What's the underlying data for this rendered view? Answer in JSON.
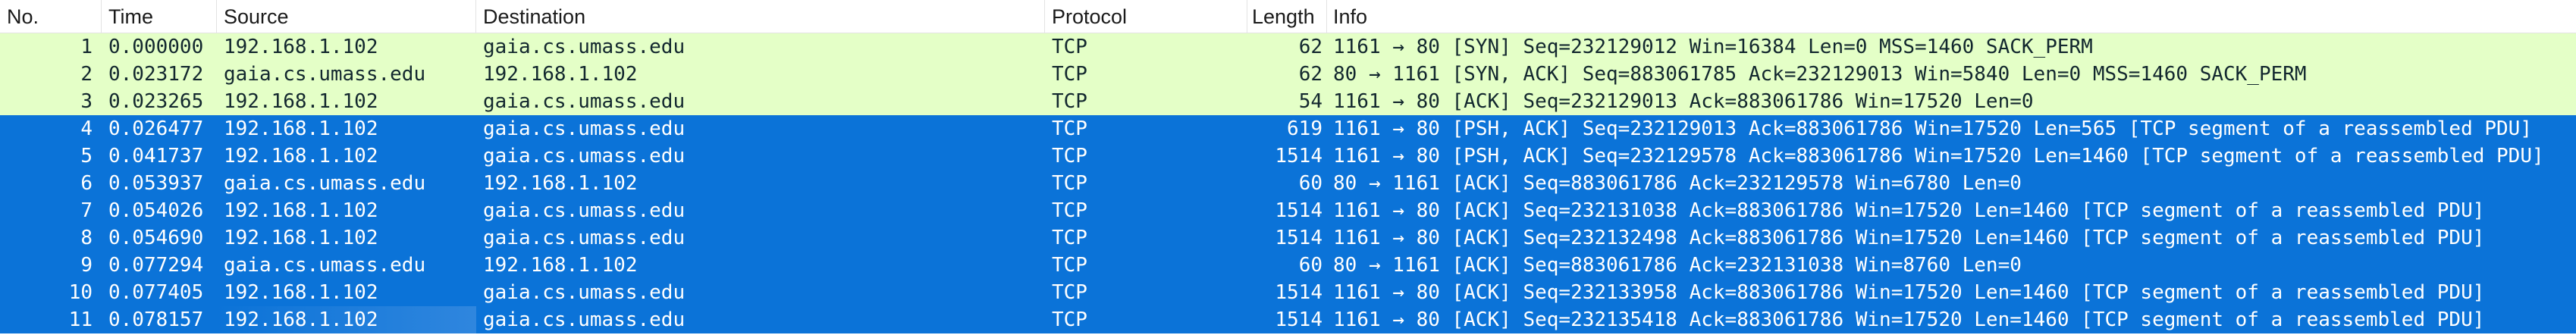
{
  "columns": {
    "no": "No.",
    "time": "Time",
    "source": "Source",
    "destination": "Destination",
    "protocol": "Protocol",
    "length": "Length",
    "info": "Info"
  },
  "colors": {
    "tcp_handshake_row": "#e4ffc7",
    "selected_row": "#0b73d8",
    "selected_text": "#ffffff"
  },
  "rows": [
    {
      "no": "1",
      "time": "0.000000",
      "source": "192.168.1.102",
      "destination": "gaia.cs.umass.edu",
      "protocol": "TCP",
      "length": "62",
      "info": "1161 → 80 [SYN] Seq=232129012 Win=16384 Len=0 MSS=1460 SACK_PERM",
      "style": "green"
    },
    {
      "no": "2",
      "time": "0.023172",
      "source": "gaia.cs.umass.edu",
      "destination": "192.168.1.102",
      "protocol": "TCP",
      "length": "62",
      "info": "80 → 1161 [SYN, ACK] Seq=883061785 Ack=232129013 Win=5840 Len=0 MSS=1460 SACK_PERM",
      "style": "green"
    },
    {
      "no": "3",
      "time": "0.023265",
      "source": "192.168.1.102",
      "destination": "gaia.cs.umass.edu",
      "protocol": "TCP",
      "length": "54",
      "info": "1161 → 80 [ACK] Seq=232129013 Ack=883061786 Win=17520 Len=0",
      "style": "green"
    },
    {
      "no": "4",
      "time": "0.026477",
      "source": "192.168.1.102",
      "destination": "gaia.cs.umass.edu",
      "protocol": "TCP",
      "length": "619",
      "info": "1161 → 80 [PSH, ACK] Seq=232129013 Ack=883061786 Win=17520 Len=565 [TCP segment of a reassembled PDU]",
      "style": "blue"
    },
    {
      "no": "5",
      "time": "0.041737",
      "source": "192.168.1.102",
      "destination": "gaia.cs.umass.edu",
      "protocol": "TCP",
      "length": "1514",
      "info": "1161 → 80 [PSH, ACK] Seq=232129578 Ack=883061786 Win=17520 Len=1460 [TCP segment of a reassembled PDU]",
      "style": "blue"
    },
    {
      "no": "6",
      "time": "0.053937",
      "source": "gaia.cs.umass.edu",
      "destination": "192.168.1.102",
      "protocol": "TCP",
      "length": "60",
      "info": "80 → 1161 [ACK] Seq=883061786 Ack=232129578 Win=6780 Len=0",
      "style": "blue"
    },
    {
      "no": "7",
      "time": "0.054026",
      "source": "192.168.1.102",
      "destination": "gaia.cs.umass.edu",
      "protocol": "TCP",
      "length": "1514",
      "info": "1161 → 80 [ACK] Seq=232131038 Ack=883061786 Win=17520 Len=1460 [TCP segment of a reassembled PDU]",
      "style": "blue"
    },
    {
      "no": "8",
      "time": "0.054690",
      "source": "192.168.1.102",
      "destination": "gaia.cs.umass.edu",
      "protocol": "TCP",
      "length": "1514",
      "info": "1161 → 80 [ACK] Seq=232132498 Ack=883061786 Win=17520 Len=1460 [TCP segment of a reassembled PDU]",
      "style": "blue"
    },
    {
      "no": "9",
      "time": "0.077294",
      "source": "gaia.cs.umass.edu",
      "destination": "192.168.1.102",
      "protocol": "TCP",
      "length": "60",
      "info": "80 → 1161 [ACK] Seq=883061786 Ack=232131038 Win=8760 Len=0",
      "style": "blue"
    },
    {
      "no": "10",
      "time": "0.077405",
      "source": "192.168.1.102",
      "destination": "gaia.cs.umass.edu",
      "protocol": "TCP",
      "length": "1514",
      "info": "1161 → 80 [ACK] Seq=232133958 Ack=883061786 Win=17520 Len=1460 [TCP segment of a reassembled PDU]",
      "style": "blue"
    },
    {
      "no": "11",
      "time": "0.078157",
      "source": "192.168.1.102",
      "destination": "gaia.cs.umass.edu",
      "protocol": "TCP",
      "length": "1514",
      "info": "1161 → 80 [ACK] Seq=232135418 Ack=883061786 Win=17520 Len=1460 [TCP segment of a reassembled PDU]",
      "style": "blue"
    }
  ]
}
